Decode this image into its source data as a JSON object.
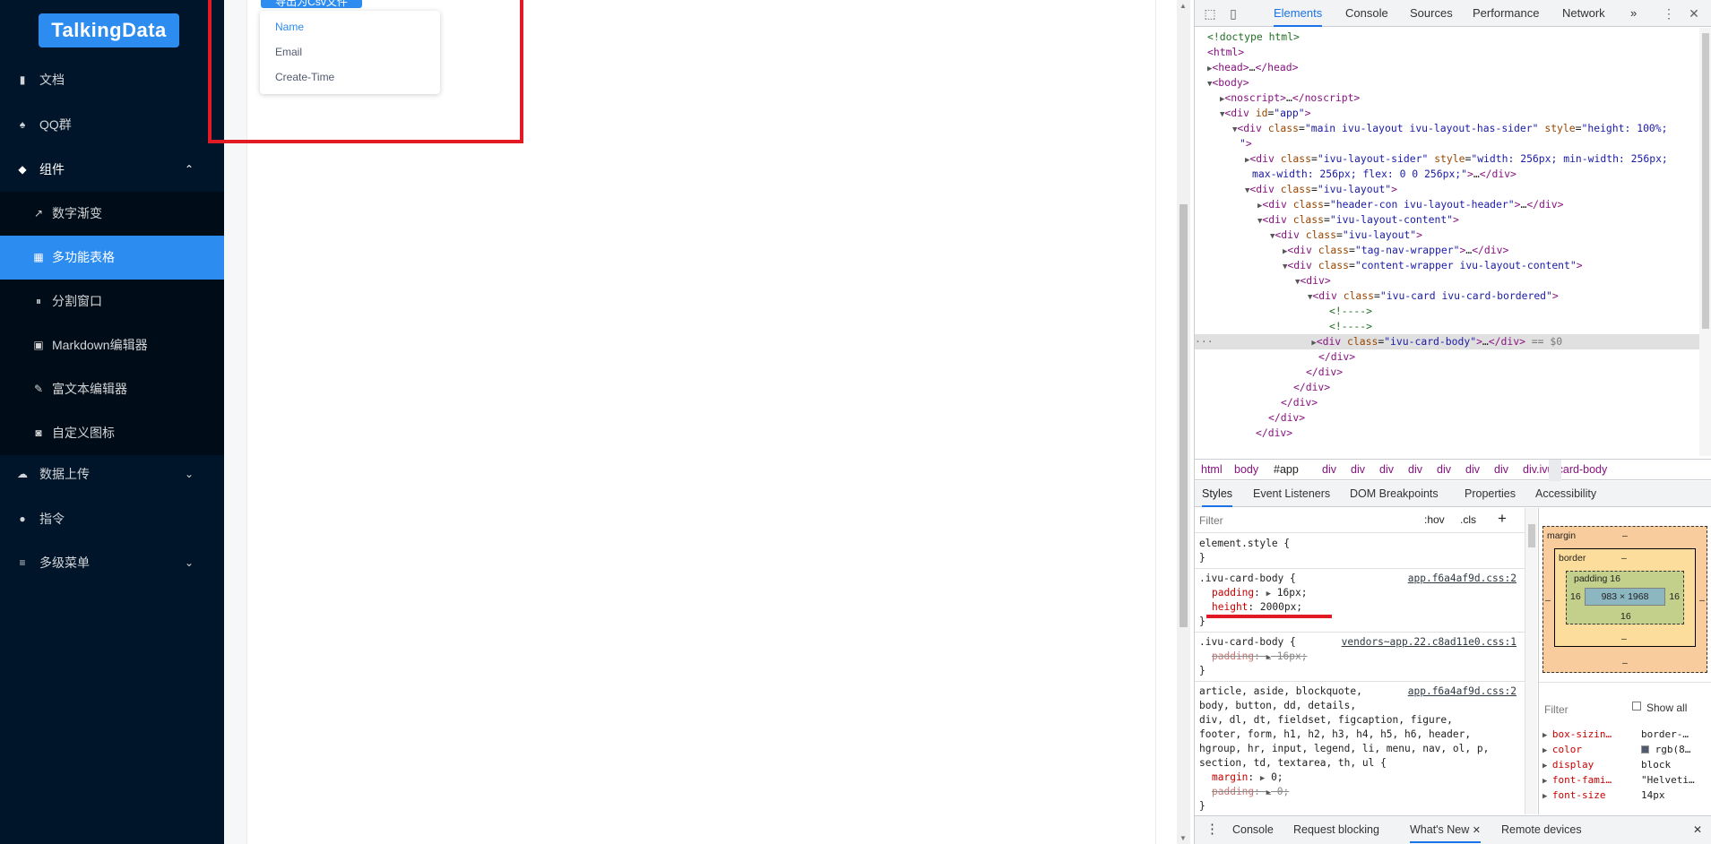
{
  "sidebar": {
    "logo": "TalkingData",
    "items": [
      {
        "icon": "book-icon",
        "glyph": "▮",
        "label": "文档"
      },
      {
        "icon": "qq-icon",
        "glyph": "♠",
        "label": "QQ群"
      },
      {
        "icon": "layers-icon",
        "glyph": "◆",
        "label": "组件",
        "chevron": "⌃"
      },
      {
        "icon": "trend-icon",
        "glyph": "↗",
        "label": "数字渐变"
      },
      {
        "icon": "grid-icon",
        "glyph": "▦",
        "label": "多功能表格"
      },
      {
        "icon": "pause-icon",
        "glyph": "⏸",
        "label": "分割窗口"
      },
      {
        "icon": "markdown-icon",
        "glyph": "▣",
        "label": "Markdown编辑器"
      },
      {
        "icon": "edit-icon",
        "glyph": "✎",
        "label": "富文本编辑器"
      },
      {
        "icon": "custom-icon",
        "glyph": "◙",
        "label": "自定义图标"
      },
      {
        "icon": "cloud-upload-icon",
        "glyph": "☁",
        "label": "数据上传",
        "chevron": "⌄"
      },
      {
        "icon": "command-icon",
        "glyph": "●",
        "label": "指令"
      },
      {
        "icon": "menu-icon",
        "glyph": "≡",
        "label": "多级菜单",
        "chevron": "⌄"
      }
    ]
  },
  "main": {
    "export_button": "导出为Csv文件",
    "dropdown": [
      "Name",
      "Email",
      "Create-Time"
    ]
  },
  "devtools": {
    "tabs": [
      "Elements",
      "Console",
      "Sources",
      "Performance",
      "Network"
    ],
    "more": "»",
    "dom_lines": [
      {
        "indent": 1,
        "tri": "",
        "html": "<span class='cm'>&lt;!doctype html&gt;</span>"
      },
      {
        "indent": 1,
        "tri": "",
        "html": "<span class='tg'>&lt;html&gt;</span>"
      },
      {
        "indent": 1,
        "tri": "▶",
        "html": "<span class='tg'>&lt;head&gt;</span>…<span class='tg'>&lt;/head&gt;</span>"
      },
      {
        "indent": 1,
        "tri": "▼",
        "html": "<span class='tg'>&lt;body&gt;</span>"
      },
      {
        "indent": 2,
        "tri": "▶",
        "html": "<span class='tg'>&lt;noscript&gt;</span>…<span class='tg'>&lt;/noscript&gt;</span>"
      },
      {
        "indent": 2,
        "tri": "▼",
        "html": "<span class='tg'>&lt;div</span> <span class='an'>id</span>=<span class='av'>\"app\"</span><span class='tg'>&gt;</span>"
      }
    ],
    "breadcrumbs": [
      "html",
      "body",
      "#app",
      "div",
      "div",
      "div",
      "div",
      "div",
      "div",
      "div",
      "div.ivu-card-body"
    ],
    "subtabs": [
      "Styles",
      "Event Listeners",
      "DOM Breakpoints",
      "Properties",
      "Accessibility"
    ],
    "filter_placeholder": "Filter",
    "hov": ":hov",
    "cls": ".cls",
    "plus": "+",
    "box_model": {
      "margin": "margin",
      "border": "border",
      "padding": "padding 16",
      "content": "983 × 1968",
      "dash": "–",
      "sixteen": "16"
    },
    "computed_filter": "Filter",
    "show_all": "Show all",
    "computed": [
      {
        "name": "box-sizin…",
        "value": "border-…"
      },
      {
        "name": "color",
        "value": "rgb(8…"
      },
      {
        "name": "display",
        "value": "block"
      },
      {
        "name": "font-fami…",
        "value": "\"Helveti…"
      },
      {
        "name": "font-size",
        "value": "14px"
      }
    ],
    "drawer": [
      "Console",
      "Request blocking",
      "What's New",
      "Remote devices"
    ],
    "drawer_close": "✕"
  }
}
